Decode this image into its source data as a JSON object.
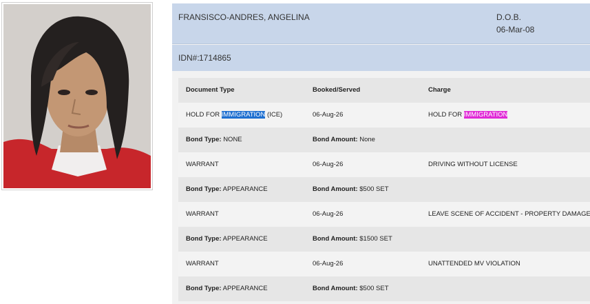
{
  "inmate": {
    "name": "FRANSISCO-ANDRES, ANGELINA",
    "dob_label": "D.O.B.",
    "dob": "06-Mar-08",
    "idn_label": "IDN#:",
    "idn": "1714865"
  },
  "table": {
    "headers": [
      "Document Type",
      "Booked/Served",
      "Charge"
    ],
    "bond_type_label": "Bond Type:",
    "bond_amount_label": "Bond Amount:",
    "records": [
      {
        "doc_type_prefix": "HOLD FOR ",
        "doc_type_highlight": "IMMIGRATION",
        "doc_type_suffix": " (ICE)",
        "booked": "06-Aug-26",
        "charge_prefix": "HOLD FOR ",
        "charge_highlight": "IMMIGRATION",
        "bond_type": "NONE",
        "bond_amount": "None"
      },
      {
        "doc_type": "WARRANT",
        "booked": "06-Aug-26",
        "charge": "DRIVING WITHOUT LICENSE",
        "bond_type": "APPEARANCE",
        "bond_amount": "$500 SET"
      },
      {
        "doc_type": "WARRANT",
        "booked": "06-Aug-26",
        "charge": "LEAVE SCENE OF ACCIDENT - PROPERTY DAMAGE",
        "bond_type": "APPEARANCE",
        "bond_amount": "$1500 SET"
      },
      {
        "doc_type": "WARRANT",
        "booked": "06-Aug-26",
        "charge": "UNATTENDED MV VIOLATION",
        "bond_type": "APPEARANCE",
        "bond_amount": "$500 SET"
      }
    ]
  },
  "colors": {
    "header_bg": "#c8d6ea",
    "highlight_blue": "#1e6fd0",
    "highlight_magenta": "#e02ad6"
  }
}
